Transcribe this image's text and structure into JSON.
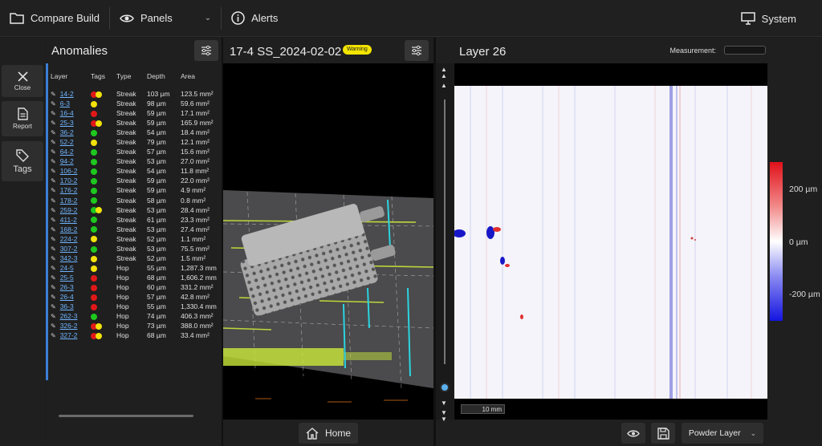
{
  "topbar": {
    "compare_build": "Compare Build",
    "panels": "Panels",
    "alerts": "Alerts",
    "system": "System"
  },
  "sidebar": {
    "close": "Close",
    "report": "Report",
    "tags": "Tags"
  },
  "anomalies": {
    "title": "Anomalies",
    "headers": [
      "Layer",
      "Tags",
      "Type",
      "Depth",
      "Area"
    ],
    "rows": [
      {
        "layer": "14-2",
        "tags": [
          "red",
          "yellow"
        ],
        "type": "Streak",
        "depth": "103 µm",
        "area": "123.5 mm²"
      },
      {
        "layer": "6-3",
        "tags": [
          "yellow"
        ],
        "type": "Streak",
        "depth": "98 µm",
        "area": "59.6 mm²"
      },
      {
        "layer": "16-4",
        "tags": [
          "red"
        ],
        "type": "Streak",
        "depth": "59 µm",
        "area": "17.1 mm²"
      },
      {
        "layer": "25-3",
        "tags": [
          "red",
          "yellow"
        ],
        "type": "Streak",
        "depth": "59 µm",
        "area": "165.9 mm²"
      },
      {
        "layer": "36-2",
        "tags": [
          "green"
        ],
        "type": "Streak",
        "depth": "54 µm",
        "area": "18.4 mm²"
      },
      {
        "layer": "52-2",
        "tags": [
          "yellow"
        ],
        "type": "Streak",
        "depth": "79 µm",
        "area": "12.1 mm²"
      },
      {
        "layer": "64-2",
        "tags": [
          "green"
        ],
        "type": "Streak",
        "depth": "57 µm",
        "area": "15.6 mm²"
      },
      {
        "layer": "94-2",
        "tags": [
          "green"
        ],
        "type": "Streak",
        "depth": "53 µm",
        "area": "27.0 mm²"
      },
      {
        "layer": "106-2",
        "tags": [
          "green"
        ],
        "type": "Streak",
        "depth": "54 µm",
        "area": "11.8 mm²"
      },
      {
        "layer": "170-2",
        "tags": [
          "green"
        ],
        "type": "Streak",
        "depth": "59 µm",
        "area": "22.0 mm²"
      },
      {
        "layer": "176-2",
        "tags": [
          "green"
        ],
        "type": "Streak",
        "depth": "59 µm",
        "area": "4.9 mm²"
      },
      {
        "layer": "178-2",
        "tags": [
          "green"
        ],
        "type": "Streak",
        "depth": "58 µm",
        "area": "0.8 mm²"
      },
      {
        "layer": "259-2",
        "tags": [
          "green",
          "yellow"
        ],
        "type": "Streak",
        "depth": "53 µm",
        "area": "28.4 mm²"
      },
      {
        "layer": "411-2",
        "tags": [
          "green"
        ],
        "type": "Streak",
        "depth": "61 µm",
        "area": "23.3 mm²"
      },
      {
        "layer": "168-2",
        "tags": [
          "green"
        ],
        "type": "Streak",
        "depth": "53 µm",
        "area": "27.4 mm²"
      },
      {
        "layer": "224-2",
        "tags": [
          "yellow"
        ],
        "type": "Streak",
        "depth": "52 µm",
        "area": "1.1 mm²"
      },
      {
        "layer": "307-2",
        "tags": [
          "green"
        ],
        "type": "Streak",
        "depth": "53 µm",
        "area": "75.5 mm²"
      },
      {
        "layer": "342-3",
        "tags": [
          "yellow"
        ],
        "type": "Streak",
        "depth": "52 µm",
        "area": "1.5 mm²"
      },
      {
        "layer": "24-5",
        "tags": [
          "yellow"
        ],
        "type": "Hop",
        "depth": "55 µm",
        "area": "1,287.3 mm"
      },
      {
        "layer": "25-5",
        "tags": [
          "red"
        ],
        "type": "Hop",
        "depth": "68 µm",
        "area": "1,606.2 mm"
      },
      {
        "layer": "26-3",
        "tags": [
          "red"
        ],
        "type": "Hop",
        "depth": "60 µm",
        "area": "331.2 mm²"
      },
      {
        "layer": "26-4",
        "tags": [
          "red"
        ],
        "type": "Hop",
        "depth": "57 µm",
        "area": "42.8 mm²"
      },
      {
        "layer": "36-3",
        "tags": [
          "red"
        ],
        "type": "Hop",
        "depth": "55 µm",
        "area": "1,330.4 mm"
      },
      {
        "layer": "262-3",
        "tags": [
          "green"
        ],
        "type": "Hop",
        "depth": "74 µm",
        "area": "406.3 mm²"
      },
      {
        "layer": "326-2",
        "tags": [
          "red",
          "yellow"
        ],
        "type": "Hop",
        "depth": "73 µm",
        "area": "388.0 mm²"
      },
      {
        "layer": "327-2",
        "tags": [
          "red",
          "yellow"
        ],
        "type": "Hop",
        "depth": "68 µm",
        "area": "33.4 mm²"
      }
    ]
  },
  "viewer3d": {
    "title": "17-4 SS_2024-02-02",
    "badge": "Warning",
    "home": "Home"
  },
  "layer_view": {
    "title": "Layer 26",
    "measurement_label": "Measurement:",
    "scale_bar": "10 mm",
    "colorbar_ticks": [
      "200 µm",
      "0 µm",
      "-200 µm"
    ],
    "powder_layer": "Powder Layer"
  },
  "colors": {
    "red": "#e01818",
    "yellow": "#f2e20a",
    "green": "#1ec81e",
    "link": "#6fb5ff",
    "accent": "#3b7fd6",
    "warning": "#f3e500"
  }
}
